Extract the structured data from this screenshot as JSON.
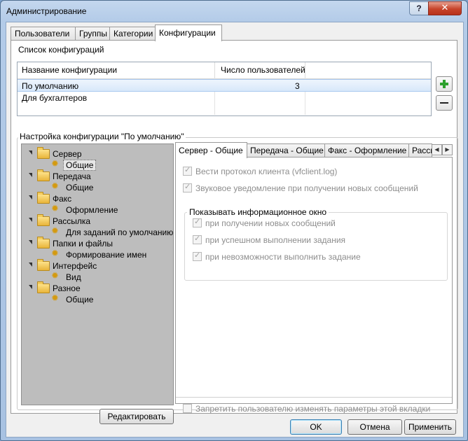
{
  "window": {
    "title": "Администрирование",
    "help": "?",
    "close": "✕"
  },
  "top_tabs": [
    "Пользователи",
    "Группы",
    "Категории",
    "Конфигурации"
  ],
  "config_list": {
    "label": "Список конфигураций",
    "columns": [
      "Название конфигурации",
      "Число пользователей"
    ],
    "rows": [
      {
        "name": "По умолчанию",
        "users": "3"
      },
      {
        "name": "Для бухгалтеров",
        "users": ""
      }
    ]
  },
  "settings": {
    "label": "Настройка конфигурации \"По умолчанию\"",
    "tree": [
      {
        "label": "Сервер",
        "children": [
          "Общие"
        ]
      },
      {
        "label": "Передача",
        "children": [
          "Общие"
        ]
      },
      {
        "label": "Факс",
        "children": [
          "Оформление"
        ]
      },
      {
        "label": "Рассылка",
        "children": [
          "Для заданий по умолчанию"
        ]
      },
      {
        "label": "Папки и файлы",
        "children": [
          "Формирование имен"
        ]
      },
      {
        "label": "Интерфейс",
        "children": [
          "Вид"
        ]
      },
      {
        "label": "Разное",
        "children": [
          "Общие"
        ]
      }
    ],
    "edit_button": "Редактировать",
    "inner_tabs": [
      "Сервер - Общие",
      "Передача - Общие",
      "Факс - Оформление",
      "Рассы"
    ],
    "checkboxes": [
      {
        "label": "Вести протокол клиента (vfclient.log)",
        "checked": true
      },
      {
        "label": "Звуковое уведомление при получении новых сообщений",
        "checked": true
      }
    ],
    "info_window": {
      "label": "Показывать информационное окно",
      "options": [
        {
          "label": "при получении новых сообщений",
          "checked": true
        },
        {
          "label": "при успешном выполнении задания",
          "checked": true
        },
        {
          "label": "при невозможности выполнить задание",
          "checked": true
        }
      ]
    },
    "lock_checkbox": {
      "label": "Запретить пользователю изменять параметры этой вкладки",
      "checked": false
    }
  },
  "buttons": {
    "ok": "OK",
    "cancel": "Отмена",
    "apply": "Применить"
  },
  "icons": {
    "add": "plus-icon",
    "remove": "minus-icon",
    "folder": "folder-icon",
    "gear": "gear-icon"
  },
  "colors": {
    "add_icon": "#2ea12e",
    "tree_bg": "#bdbdbd",
    "selection": "#d8e8fa"
  }
}
